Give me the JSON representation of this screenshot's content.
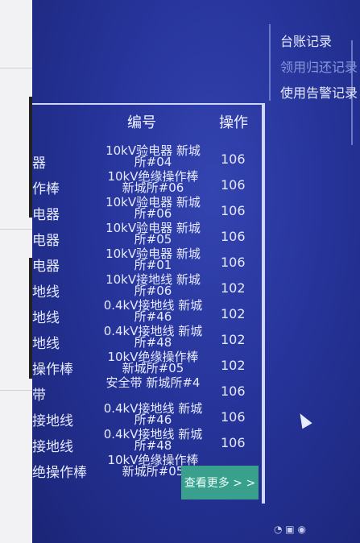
{
  "menu": {
    "items": [
      {
        "label": "台账记录"
      },
      {
        "label": "领用归还记录"
      },
      {
        "label": "使用告警记录"
      }
    ]
  },
  "table": {
    "headers": {
      "number": "编号",
      "operation": "操作"
    },
    "rows": [
      {
        "name": "器",
        "num1": "10kV验电器 新城",
        "num2": "所#04",
        "op": "106"
      },
      {
        "name": "作棒",
        "num1": "10kV绝缘操作棒",
        "num2": "新城所#06",
        "op": "106"
      },
      {
        "name": "电器",
        "num1": "10kV验电器 新城",
        "num2": "所#06",
        "op": "106"
      },
      {
        "name": "电器",
        "num1": "10kV验电器 新城",
        "num2": "所#05",
        "op": "106"
      },
      {
        "name": "电器",
        "num1": "10kV验电器 新城",
        "num2": "所#01",
        "op": "106"
      },
      {
        "name": "地线",
        "num1": "10kV接地线 新城",
        "num2": "所#06",
        "op": "102"
      },
      {
        "name": "地线",
        "num1": "0.4kV接地线 新城",
        "num2": "所#46",
        "op": "102"
      },
      {
        "name": "地线",
        "num1": "0.4kV接地线 新城",
        "num2": "所#48",
        "op": "102"
      },
      {
        "name": "操作棒",
        "num1": "10kV绝缘操作棒",
        "num2": "新城所#05",
        "op": "102"
      },
      {
        "name": "带",
        "num1": "安全带 新城所#4",
        "num2": "",
        "op": "106"
      },
      {
        "name": "接地线",
        "num1": "0.4kV接地线 新城",
        "num2": "所#46",
        "op": "106"
      },
      {
        "name": "接地线",
        "num1": "0.4kV接地线 新城",
        "num2": "所#48",
        "op": "106"
      },
      {
        "name": "绝操作棒",
        "num1": "10kV绝缘操作棒",
        "num2": "新城所#05",
        "op": ""
      }
    ]
  },
  "more_button": {
    "label": "查看更多 > >"
  }
}
